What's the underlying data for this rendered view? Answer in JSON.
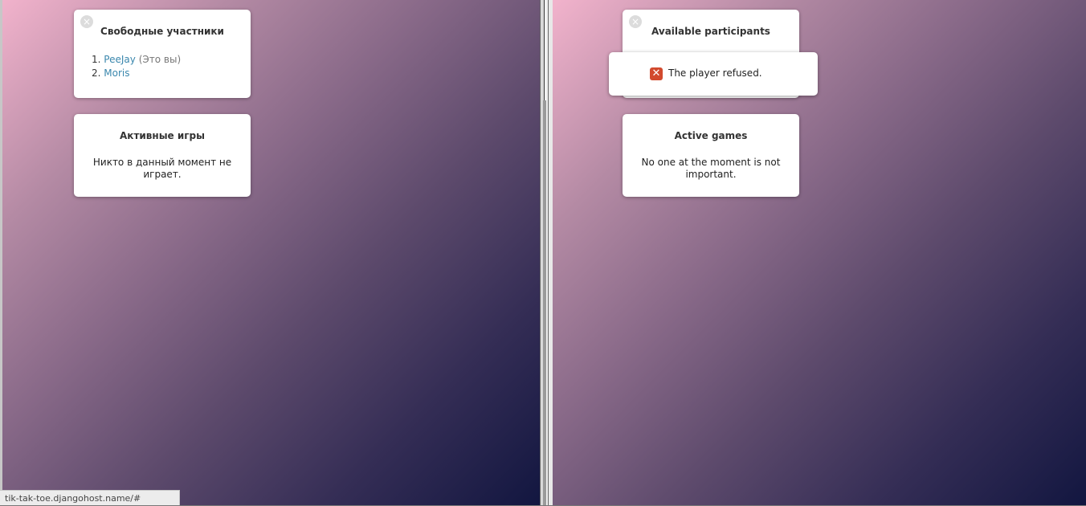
{
  "left": {
    "participants": {
      "title": "Свободные участники",
      "items": [
        {
          "num": "1.",
          "name": "PeeJay",
          "note": "(Это вы)"
        },
        {
          "num": "2.",
          "name": "Moris",
          "note": ""
        }
      ]
    },
    "games": {
      "title": "Активные игры",
      "empty": "Никто в данный момент не играет."
    }
  },
  "right": {
    "participants": {
      "title": "Available participants"
    },
    "games": {
      "title": "Active games",
      "empty": "No one at the moment is not important."
    },
    "notification": {
      "text": "The player refused.",
      "icon": "error-x-icon"
    }
  },
  "close_icon": "×",
  "error_icon": "✕",
  "status_url": "tik-tak-toe.djangohost.name/#",
  "colors": {
    "link": "#3a87ad",
    "error": "#d24a2e"
  }
}
